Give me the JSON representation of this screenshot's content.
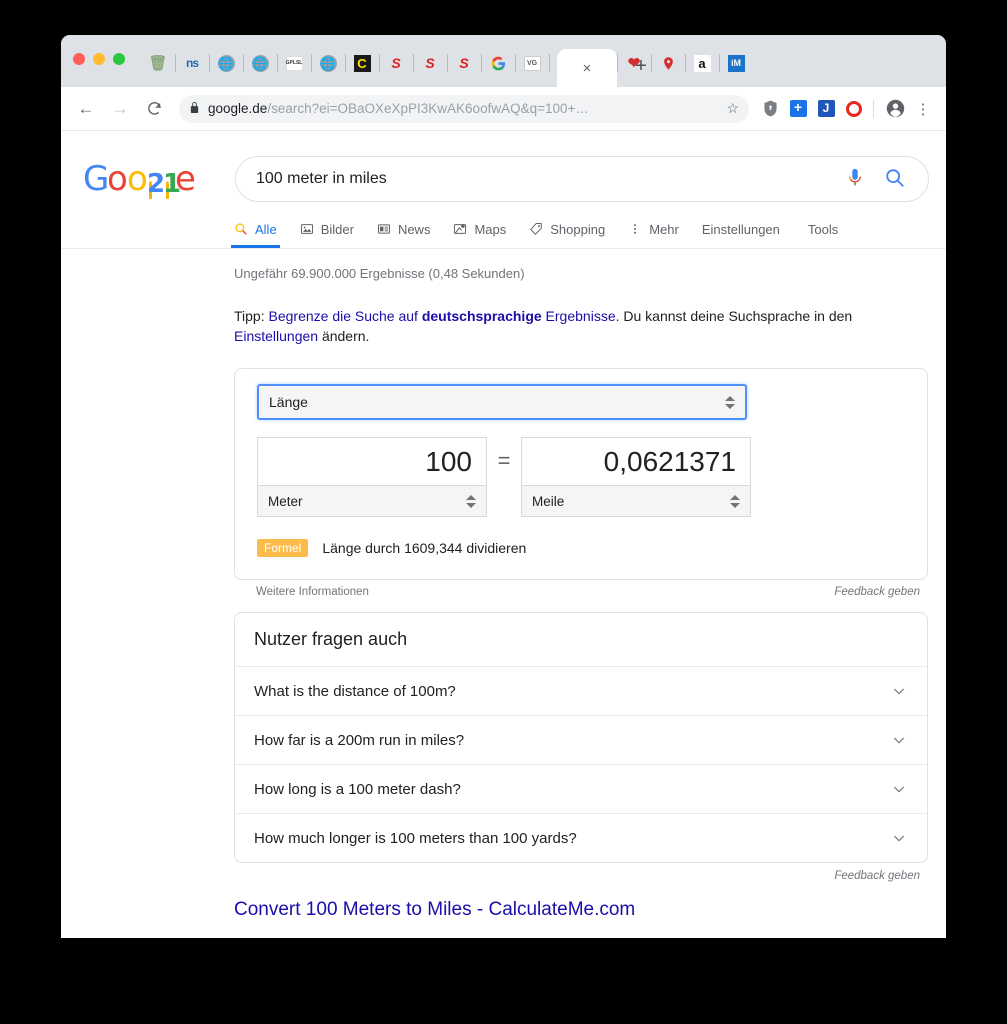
{
  "browser": {
    "traffic_lights": [
      "close",
      "minimize",
      "maximize"
    ],
    "pinned_tabs": [
      {
        "name": "trash-icon",
        "label": "Ὕ1"
      },
      {
        "name": "ns-icon",
        "label": "NS"
      },
      {
        "name": "globe-icon-1",
        "label": "⊕"
      },
      {
        "name": "globe-icon-2",
        "label": "⊕"
      },
      {
        "name": "gplsl-icon",
        "label": "GPLSL"
      },
      {
        "name": "globe-icon-3",
        "label": "⊕"
      },
      {
        "name": "c-icon",
        "label": "C"
      },
      {
        "name": "s-icon-1",
        "label": "S"
      },
      {
        "name": "s-icon-2",
        "label": "S"
      },
      {
        "name": "s-icon-3",
        "label": "S"
      },
      {
        "name": "google-icon-1",
        "label": "G"
      },
      {
        "name": "vg-icon",
        "label": "VG"
      },
      {
        "name": "s-icon-4",
        "label": "S"
      },
      {
        "name": "google-icon-2",
        "label": "G"
      },
      {
        "name": "heart-icon",
        "label": "❤"
      },
      {
        "name": "pin-icon",
        "label": "●"
      },
      {
        "name": "amazon-icon",
        "label": "a"
      },
      {
        "name": "im-icon",
        "label": "iM"
      }
    ],
    "tab_close_label": "×",
    "new_tab_label": "+",
    "back_label": "←",
    "forward_label": "→",
    "reload_label": "↻",
    "lock_label": "🔒",
    "url_domain": "google.de",
    "url_path": "/search?ei=OBaOXeXpPI3KwAK6oofwAQ&q=100+…",
    "star_label": "☆",
    "extensions": [
      {
        "name": "shield-extension-icon",
        "label": "⬟"
      },
      {
        "name": "plus-extension-icon",
        "label": "+"
      },
      {
        "name": "j-extension-icon",
        "label": "J"
      },
      {
        "name": "record-extension-icon",
        "label": ""
      }
    ],
    "profile_name": "profile-avatar",
    "menu_label": "⋮"
  },
  "logo": {
    "letters": [
      "G",
      "o",
      "o",
      "2",
      "1",
      "e"
    ],
    "alt": "Google 21st birthday doodle"
  },
  "search": {
    "query": "100 meter in miles",
    "mic_icon": "microphone-icon",
    "search_icon": "search-icon"
  },
  "nav": {
    "tabs": [
      {
        "label": "Alle",
        "icon": "search-icon",
        "active": true
      },
      {
        "label": "Bilder",
        "icon": "image-icon",
        "active": false
      },
      {
        "label": "News",
        "icon": "news-icon",
        "active": false
      },
      {
        "label": "Maps",
        "icon": "map-icon",
        "active": false
      },
      {
        "label": "Shopping",
        "icon": "tag-icon",
        "active": false
      },
      {
        "label": "Mehr",
        "icon": "more-vertical-icon",
        "active": false
      }
    ],
    "settings_label": "Einstellungen",
    "tools_label": "Tools"
  },
  "results": {
    "stats": "Ungefähr 69.900.000 Ergebnisse (0,48 Sekunden)",
    "tip": {
      "prefix": "Tipp: ",
      "link1_a": "Begrenze die Suche auf ",
      "link1_bold": "deutschsprachige",
      "link1_b": " Ergebnisse",
      "mid": ". Du kannst deine Suchsprache in den ",
      "link2": "Einstellungen",
      "suffix": " ändern."
    },
    "bottom_link": "Convert 100 Meters to Miles - CalculateMe.com"
  },
  "converter": {
    "unit_type": "Länge",
    "from_value": "100",
    "from_unit": "Meter",
    "equals": "=",
    "to_value": "0,0621371",
    "to_unit": "Meile",
    "formula_badge": "Formel",
    "formula_text": "Länge durch 1609,344 dividieren",
    "more_info": "Weitere Informationen",
    "feedback": "Feedback geben"
  },
  "people_also_ask": {
    "title": "Nutzer fragen auch",
    "questions": [
      "What is the distance of 100m?",
      "How far is a 200m run in miles?",
      "How long is a 100 meter dash?",
      "How much longer is 100 meters than 100 yards?"
    ],
    "feedback": "Feedback geben",
    "chevron": "chevron-down-icon"
  },
  "colors": {
    "accent_blue": "#1a73e8",
    "link_blue": "#1a0dab",
    "formula_orange": "#fbbc4b",
    "chrome_gray": "#dee1e6"
  }
}
